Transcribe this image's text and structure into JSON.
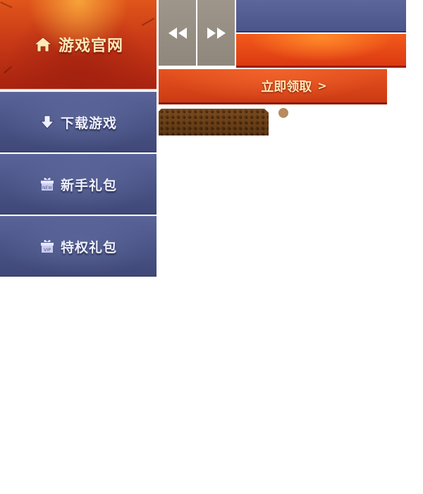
{
  "sidebar": {
    "home_label": "游戏官网",
    "download_label": "下载游戏",
    "newbie_gift_label": "新手礼包",
    "vip_gift_label": "特权礼包"
  },
  "icons": {
    "home": "home-icon",
    "download": "download-arrow-icon",
    "newbie_gift": "new-gift-icon",
    "vip_gift": "vip-gift-icon",
    "prev": "rewind-icon",
    "next": "fast-forward-icon"
  },
  "gift_badges": {
    "new": "NEW",
    "vip": "VIP"
  },
  "claim": {
    "label": "立即领取",
    "chevron": ">"
  },
  "colors": {
    "red_accent": "#c93a17",
    "blue_button": "#4a5487",
    "arrow_gray": "#8f877b",
    "orange_bar": "#e94b17",
    "hex_brown": "#6e4219",
    "dot_tan": "#b68c5e"
  }
}
